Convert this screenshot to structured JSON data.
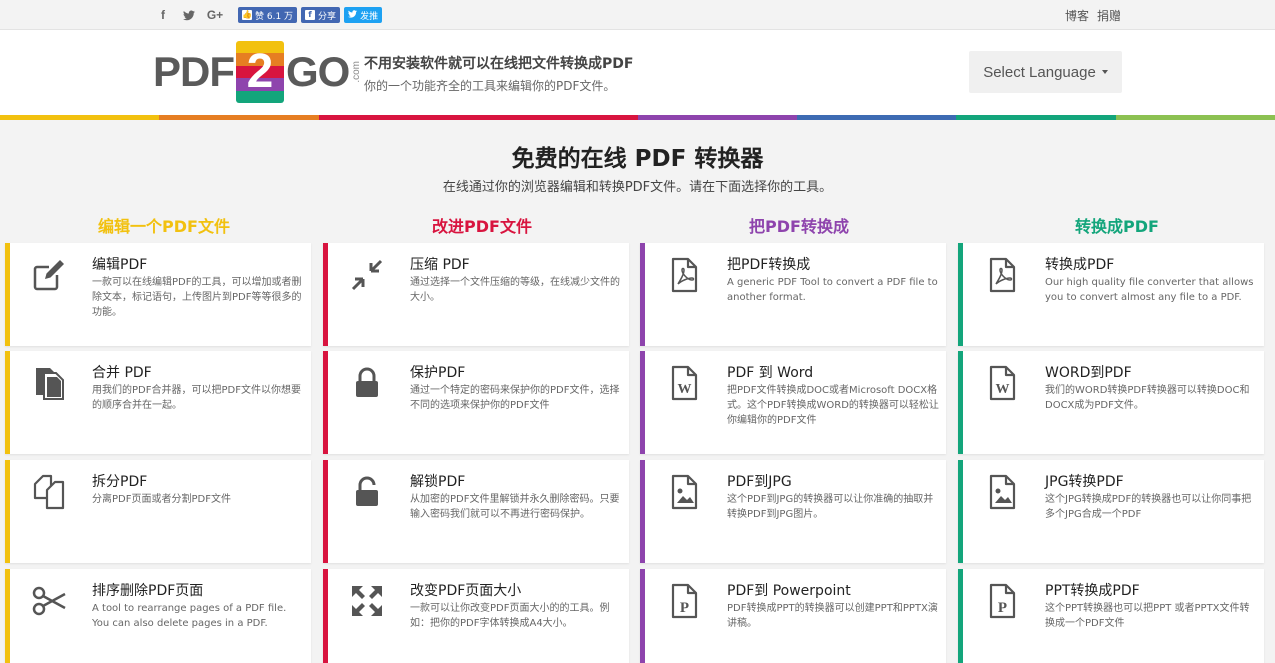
{
  "topbar": {
    "facebook_icon": "f",
    "twitter_icon": "twitter-bird-icon",
    "gplus_icon": "G+",
    "like_label": "赞 6.1 万",
    "share_label": "分享",
    "tweet_label": "发推",
    "links": [
      "博客",
      "捐赠"
    ]
  },
  "header": {
    "logo_left": "PDF",
    "logo_mid": "2",
    "logo_right": "GO",
    "logo_suffix": ".com",
    "tagline_title": "不用安装软件就可以在线把文件转换成PDF",
    "tagline_sub": "你的一个功能齐全的工具来编辑你的PDF文件。",
    "language_select": "Select Language"
  },
  "colors": {
    "yellow": "#f2c10f",
    "red": "#d8143f",
    "purple": "#8e44ad",
    "green": "#13a57b",
    "colorbar": [
      "#f2c10f",
      "#e67e22",
      "#d8143f",
      "#d8143f",
      "#8e44ad",
      "#3d6bb3",
      "#13a57b",
      "#8cc152"
    ]
  },
  "hero": {
    "title": "免费的在线 PDF 转换器",
    "subtitle": "在线通过你的浏览器编辑和转换PDF文件。请在下面选择你的工具。"
  },
  "columns": [
    {
      "heading": "编辑一个PDF文件",
      "color": "#f2c10f",
      "cards": [
        {
          "icon": "edit-icon",
          "title": "编辑PDF",
          "desc": "一款可以在线编辑PDF的工具，可以增加或者删除文本，标记语句，上传图片到PDF等等很多的功能。"
        },
        {
          "icon": "merge-icon",
          "title": "合并 PDF",
          "desc": "用我们的PDF合并器，可以把PDF文件以你想要的顺序合并在一起。"
        },
        {
          "icon": "split-icon",
          "title": "拆分PDF",
          "desc": "分离PDF页面或者分割PDF文件"
        },
        {
          "icon": "scissors-icon",
          "title": "排序删除PDF页面",
          "desc": "A tool to rearrange pages of a PDF file. You can also delete pages in a PDF."
        }
      ]
    },
    {
      "heading": "改进PDF文件",
      "color": "#d8143f",
      "cards": [
        {
          "icon": "compress-icon",
          "title": "压缩 PDF",
          "desc": "通过选择一个文件压缩的等级，在线减少文件的大小。"
        },
        {
          "icon": "lock-icon",
          "title": "保护PDF",
          "desc": "通过一个特定的密码来保护你的PDF文件，选择不同的选项来保护你的PDF文件"
        },
        {
          "icon": "unlock-icon",
          "title": "解锁PDF",
          "desc": "从加密的PDF文件里解锁并永久删除密码。只要输入密码我们就可以不再进行密码保护。"
        },
        {
          "icon": "resize-icon",
          "title": "改变PDF页面大小",
          "desc": "一款可以让你改变PDF页面大小的的工具。例如：把你的PDF字体转换成A4大小。"
        }
      ]
    },
    {
      "heading": "把PDF转换成",
      "color": "#8e44ad",
      "cards": [
        {
          "icon": "pdf-file-icon",
          "title": "把PDF转换成",
          "desc": "A generic PDF Tool to convert a PDF file to another format."
        },
        {
          "icon": "word-file-icon",
          "title": "PDF 到 Word",
          "desc": "把PDF文件转换成DOC或者Microsoft DOCX格式。这个PDF转换成WORD的转换器可以轻松让你编辑你的PDF文件"
        },
        {
          "icon": "image-file-icon",
          "title": "PDF到JPG",
          "desc": "这个PDF到JPG的转换器可以让你准确的抽取并转换PDF到JPG图片。"
        },
        {
          "icon": "ppt-file-icon",
          "title": "PDF到 Powerpoint",
          "desc": "PDF转换成PPT的转换器可以创建PPT和PPTX演讲稿。"
        }
      ]
    },
    {
      "heading": "转换成PDF",
      "color": "#13a57b",
      "cards": [
        {
          "icon": "pdf-file-icon",
          "title": "转换成PDF",
          "desc": "Our high quality file converter that allows you to convert almost any file to a PDF."
        },
        {
          "icon": "word-file-icon",
          "title": "WORD到PDF",
          "desc": "我们的WORD转换PDF转换器可以转换DOC和DOCX成为PDF文件。"
        },
        {
          "icon": "image-file-icon",
          "title": "JPG转换PDF",
          "desc": "这个JPG转换成PDF的转换器也可以让你同事把多个JPG合成一个PDF"
        },
        {
          "icon": "ppt-file-icon",
          "title": "PPT转换成PDF",
          "desc": "这个PPT转换器也可以把PPT 或者PPTX文件转换成一个PDF文件"
        }
      ]
    }
  ]
}
